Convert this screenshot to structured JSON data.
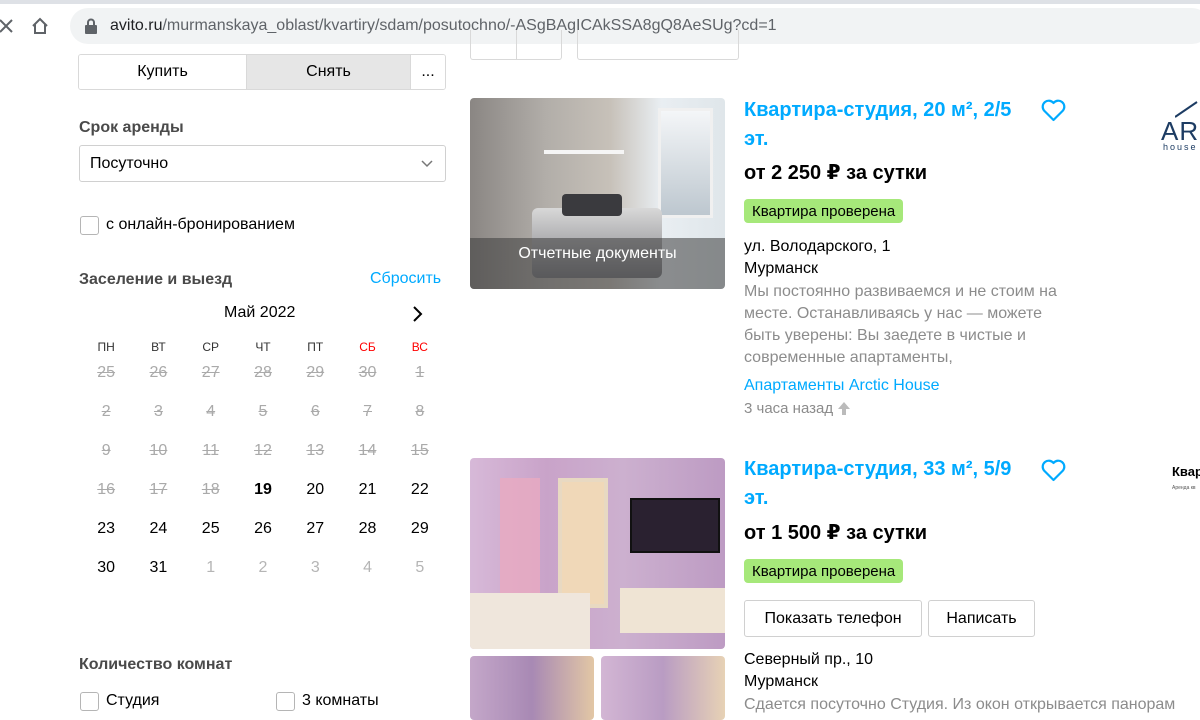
{
  "browser": {
    "url_host": "avito.ru",
    "url_path": "/murmanskaya_oblast/kvartiry/sdam/posutochno/-ASgBAgICAkSSA8gQ8AeSUg?cd=1"
  },
  "filters": {
    "deal_tabs": [
      "Купить",
      "Снять",
      "..."
    ],
    "rent_term_label": "Срок аренды",
    "rent_term_value": "Посуточно",
    "online_booking_label": "с онлайн-бронированием",
    "checkin_label": "Заселение и выезд",
    "reset_label": "Сбросить",
    "rooms_label": "Количество комнат",
    "rooms_options": [
      "Студия",
      "3 комнаты"
    ]
  },
  "calendar": {
    "month": "Май 2022",
    "weekdays": [
      "ПН",
      "ВТ",
      "СР",
      "ЧТ",
      "ПТ",
      "СБ",
      "ВС"
    ],
    "weeks": [
      [
        "25",
        "26",
        "27",
        "28",
        "29",
        "30",
        "1"
      ],
      [
        "2",
        "3",
        "4",
        "5",
        "6",
        "7",
        "8"
      ],
      [
        "9",
        "10",
        "11",
        "12",
        "13",
        "14",
        "15"
      ],
      [
        "16",
        "17",
        "18",
        "19",
        "20",
        "21",
        "22"
      ],
      [
        "23",
        "24",
        "25",
        "26",
        "27",
        "28",
        "29"
      ],
      [
        "30",
        "31",
        "1",
        "2",
        "3",
        "4",
        "5"
      ]
    ],
    "today": "19"
  },
  "listings": [
    {
      "title": "Квартира-студия, 20 м², 2/5 эт.",
      "price": "от 2 250 ₽ за сутки",
      "badge": "Квартира проверена",
      "photo_overlay": "Отчетные документы",
      "street": "ул. Володарского, 1",
      "city": "Мурманск",
      "description": "Мы постоянно развиваемся и не стоим на месте. Останавливаясь у нас — можете быть уверены: Вы заедете в чистые и современные апартаменты,",
      "seller": "Апартаменты Arctic House",
      "time": "3 часа назад",
      "logo_big": "ARC",
      "logo_small": "house"
    },
    {
      "title": "Квартира-студия, 33 м², 5/9 эт.",
      "price": "от 1 500 ₽ за сутки",
      "badge": "Квартира проверена",
      "show_phone": "Показать телефон",
      "write": "Написать",
      "street": "Северный пр., 10",
      "city": "Мурманск",
      "description": "Сдается посуточно Студия. Из окон открывается панорам",
      "logo_big": "Квар",
      "logo_small": "Аренда кв"
    }
  ]
}
